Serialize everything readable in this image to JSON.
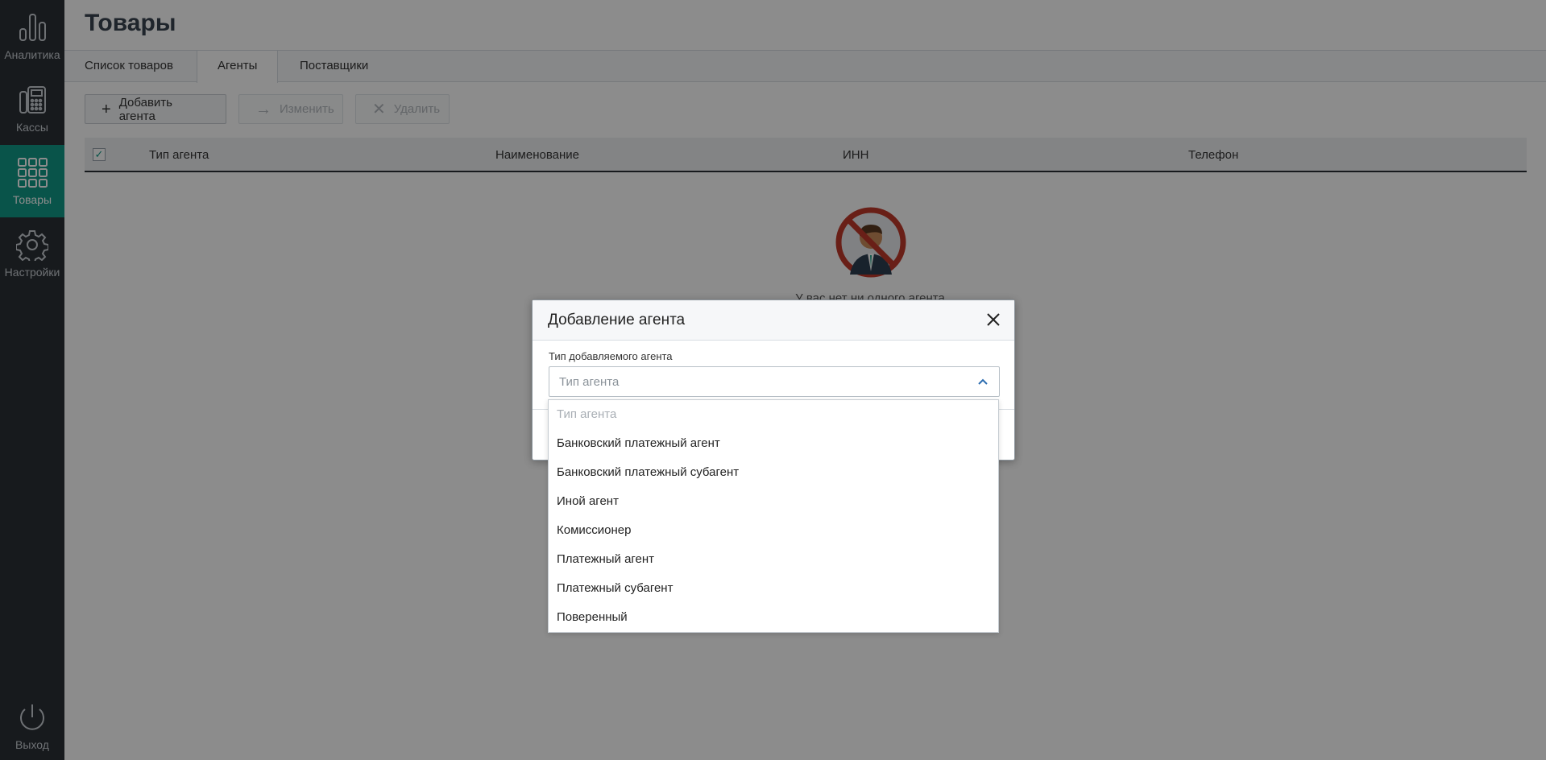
{
  "sidebar": {
    "items": [
      {
        "label": "Аналитика",
        "icon": "chart-bars-icon"
      },
      {
        "label": "Кассы",
        "icon": "cash-register-icon"
      },
      {
        "label": "Товары",
        "icon": "grid-icon",
        "active": true
      },
      {
        "label": "Настройки",
        "icon": "gear-icon"
      }
    ],
    "logout": {
      "label": "Выход",
      "icon": "power-icon"
    }
  },
  "page": {
    "title": "Товары"
  },
  "tabs": [
    {
      "label": "Список товаров"
    },
    {
      "label": "Агенты",
      "active": true
    },
    {
      "label": "Поставщики"
    }
  ],
  "toolbar": {
    "add_label": "Добавить агента",
    "edit_label": "Изменить",
    "delete_label": "Удалить"
  },
  "table": {
    "columns": [
      "Тип агента",
      "Наименование",
      "ИНН",
      "Телефон"
    ]
  },
  "empty_state": {
    "text": "У вас нет ни одного агента"
  },
  "modal": {
    "title": "Добавление агента",
    "field_label": "Тип добавляемого агента",
    "select_placeholder": "Тип агента"
  },
  "dropdown": {
    "options": [
      "Тип агента",
      "Банковский платежный агент",
      "Банковский платежный субагент",
      "Иной агент",
      "Комиссионер",
      "Платежный агент",
      "Платежный субагент",
      "Поверенный"
    ]
  },
  "colors": {
    "accent": "#119a87",
    "sidebar": "#2b3036",
    "prohibited": "#c0392b"
  }
}
